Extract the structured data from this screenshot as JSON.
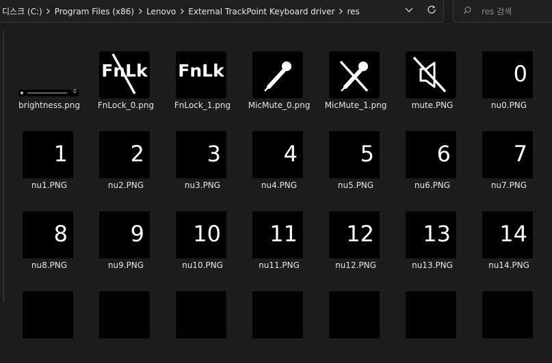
{
  "address": {
    "crumbs": [
      "디스크 (C:)",
      "Program Files (x86)",
      "Lenovo",
      "External TrackPoint Keyboard driver",
      "res"
    ]
  },
  "search": {
    "placeholder": "res 검색"
  },
  "icons": {
    "separator": "chevron-right-icon",
    "address_dropdown": "chevron-down-icon",
    "refresh": "refresh-icon",
    "search": "search-icon"
  },
  "files": [
    {
      "name": "brightness.png",
      "thumb": "brightness",
      "bar_label": "0"
    },
    {
      "name": "FnLock_0.png",
      "thumb": "fnlock-off",
      "text": "FnLk"
    },
    {
      "name": "FnLock_1.png",
      "thumb": "fnlock-on",
      "text": "FnLk"
    },
    {
      "name": "MicMute_0.png",
      "thumb": "mic"
    },
    {
      "name": "MicMute_1.png",
      "thumb": "mic-mute"
    },
    {
      "name": "mute.PNG",
      "thumb": "speaker-mute"
    },
    {
      "name": "nu0.PNG",
      "thumb": "number",
      "text": "0"
    },
    {
      "name": "nu1.PNG",
      "thumb": "number",
      "text": "1"
    },
    {
      "name": "nu2.PNG",
      "thumb": "number",
      "text": "2"
    },
    {
      "name": "nu3.PNG",
      "thumb": "number",
      "text": "3"
    },
    {
      "name": "nu4.PNG",
      "thumb": "number",
      "text": "4"
    },
    {
      "name": "nu5.PNG",
      "thumb": "number",
      "text": "5"
    },
    {
      "name": "nu6.PNG",
      "thumb": "number",
      "text": "6"
    },
    {
      "name": "nu7.PNG",
      "thumb": "number",
      "text": "7"
    },
    {
      "name": "nu8.PNG",
      "thumb": "number",
      "text": "8"
    },
    {
      "name": "nu9.PNG",
      "thumb": "number",
      "text": "9"
    },
    {
      "name": "nu10.PNG",
      "thumb": "number",
      "text": "10"
    },
    {
      "name": "nu11.PNG",
      "thumb": "number",
      "text": "11"
    },
    {
      "name": "nu12.PNG",
      "thumb": "number",
      "text": "12"
    },
    {
      "name": "nu13.PNG",
      "thumb": "number",
      "text": "13"
    },
    {
      "name": "nu14.PNG",
      "thumb": "number",
      "text": "14"
    },
    {
      "name": "",
      "thumb": "number",
      "text": ""
    },
    {
      "name": "",
      "thumb": "number",
      "text": ""
    },
    {
      "name": "",
      "thumb": "number",
      "text": ""
    },
    {
      "name": "",
      "thumb": "number",
      "text": ""
    },
    {
      "name": "",
      "thumb": "number",
      "text": ""
    },
    {
      "name": "",
      "thumb": "number",
      "text": ""
    },
    {
      "name": "",
      "thumb": "number",
      "text": ""
    }
  ],
  "colors": {
    "background": "#1c1c1c",
    "thumb": "#000000",
    "text": "#e6e6e6"
  }
}
